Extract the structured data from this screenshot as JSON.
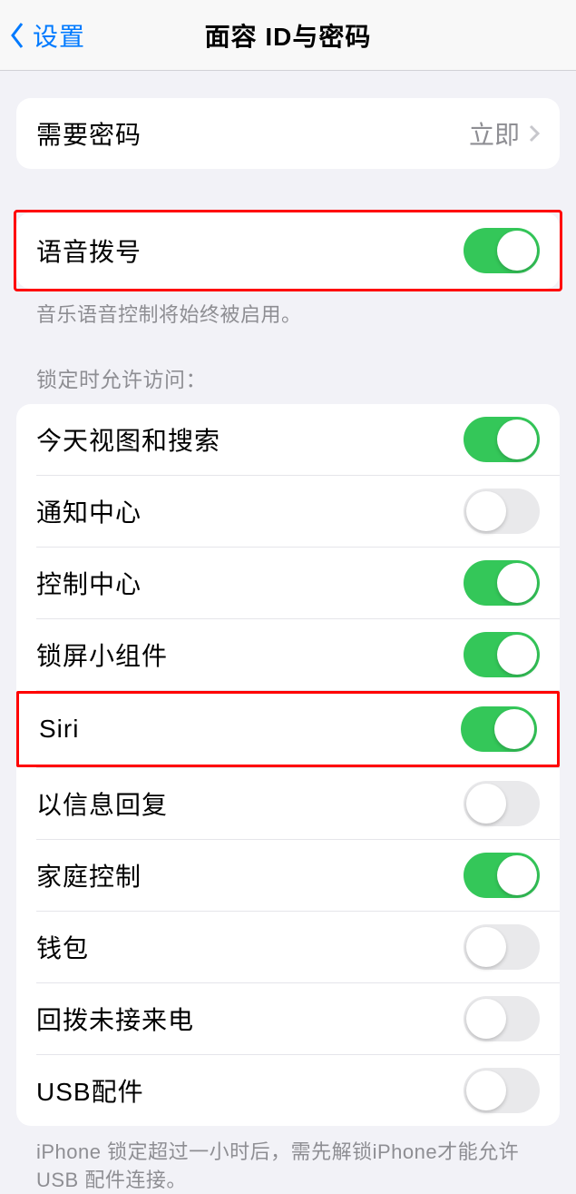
{
  "nav": {
    "back": "设置",
    "title": "面容 ID与密码"
  },
  "require_passcode": {
    "label": "需要密码",
    "value": "立即"
  },
  "voice_dial": {
    "label": "语音拨号",
    "footer": "音乐语音控制将始终被启用。",
    "on": true
  },
  "lock_section": {
    "header": "锁定时允许访问：",
    "items": [
      {
        "label": "今天视图和搜索",
        "on": true,
        "highlighted": false
      },
      {
        "label": "通知中心",
        "on": false,
        "highlighted": false
      },
      {
        "label": "控制中心",
        "on": true,
        "highlighted": false
      },
      {
        "label": "锁屏小组件",
        "on": true,
        "highlighted": false
      },
      {
        "label": "Siri",
        "on": true,
        "highlighted": true
      },
      {
        "label": "以信息回复",
        "on": false,
        "highlighted": false
      },
      {
        "label": "家庭控制",
        "on": true,
        "highlighted": false
      },
      {
        "label": "钱包",
        "on": false,
        "highlighted": false
      },
      {
        "label": "回拨未接来电",
        "on": false,
        "highlighted": false
      },
      {
        "label": "USB配件",
        "on": false,
        "highlighted": false
      }
    ],
    "footer": "iPhone 锁定超过一小时后，需先解锁iPhone才能允许USB 配件连接。"
  }
}
